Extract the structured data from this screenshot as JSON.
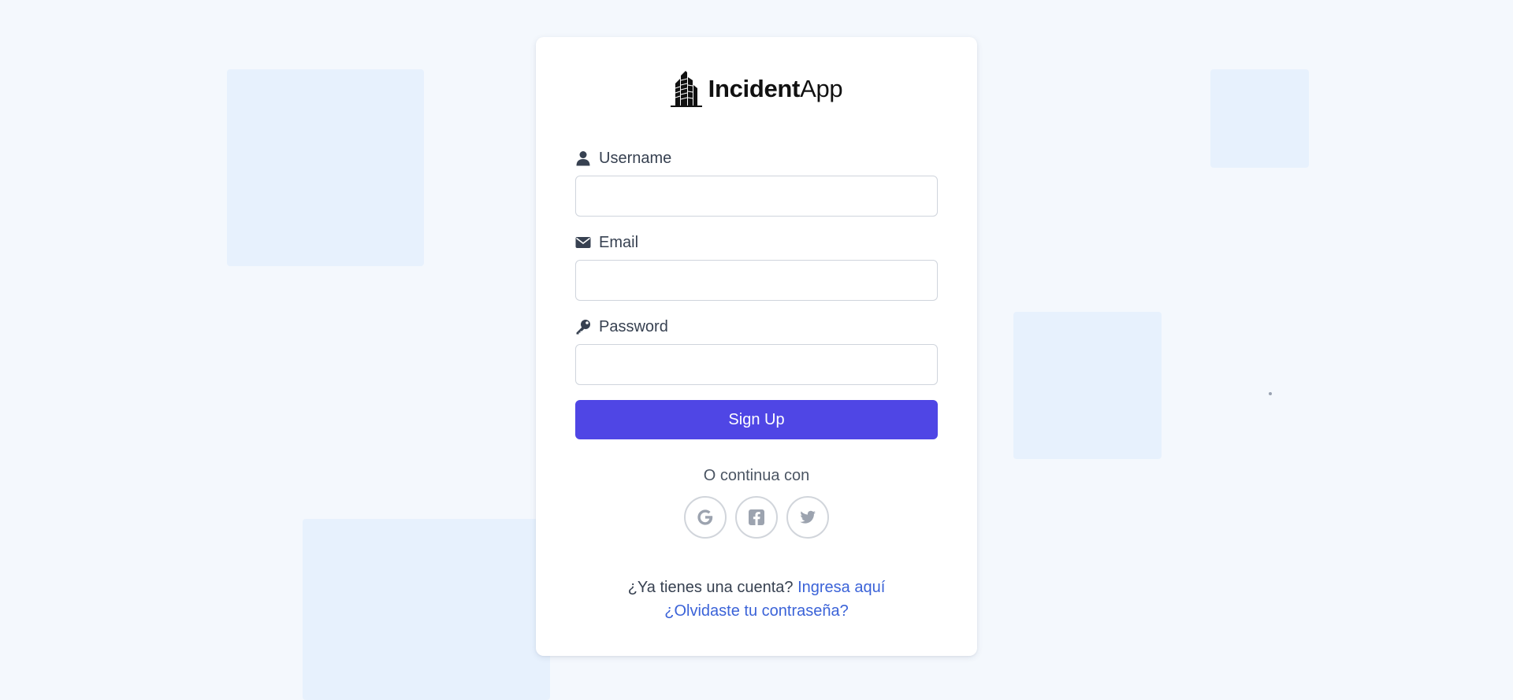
{
  "brand": {
    "name_bold": "Incident",
    "name_regular": "App",
    "logo_icon": "building-icon"
  },
  "form": {
    "username": {
      "label": "Username",
      "icon": "user-icon",
      "value": "",
      "placeholder": ""
    },
    "email": {
      "label": "Email",
      "icon": "envelope-icon",
      "value": "",
      "placeholder": ""
    },
    "password": {
      "label": "Password",
      "icon": "key-icon",
      "value": "",
      "placeholder": ""
    },
    "submit_label": "Sign Up"
  },
  "social": {
    "divider_text": "O continua con",
    "providers": [
      {
        "name": "Google",
        "icon": "google-icon"
      },
      {
        "name": "Facebook",
        "icon": "facebook-icon"
      },
      {
        "name": "Twitter",
        "icon": "twitter-icon"
      }
    ]
  },
  "footer": {
    "have_account_text": "¿Ya tienes una cuenta?",
    "login_link": "Ingresa aquí",
    "forgot_link": "¿Olvidaste tu contraseña?"
  },
  "colors": {
    "background": "#f4f8fd",
    "decor_squares": "#e7f1fd",
    "primary_button": "#4f46e5",
    "link": "#3b63d8",
    "label_text": "#374151"
  }
}
